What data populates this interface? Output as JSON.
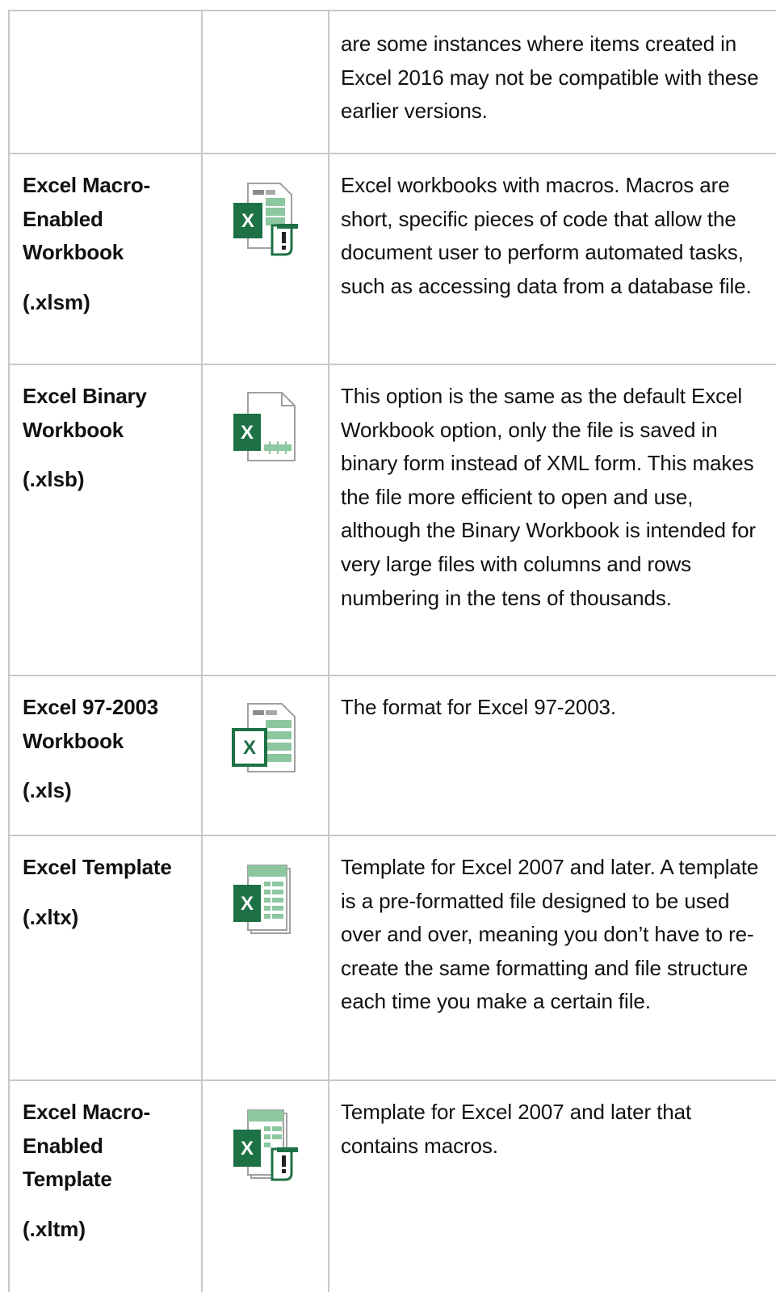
{
  "rows": [
    {
      "name": "",
      "extension": "",
      "icon": "",
      "description": "are some instances where items created in Excel 2016 may not be compatible with these earlier versions."
    },
    {
      "name": "Excel Macro-Enabled Workbook",
      "extension": "(.xlsm)",
      "icon": "excel-macro-workbook-icon",
      "description": "Excel workbooks with macros. Macros are short, specific pieces of code that allow the document user to perform automated tasks, such as accessing data from a database file."
    },
    {
      "name": "Excel Binary Workbook",
      "extension": "(.xlsb)",
      "icon": "excel-binary-workbook-icon",
      "description": "This option is the same as the default Excel Workbook option, only the file is saved in binary form instead of XML form. This makes the file more efficient to open and use, although the Binary Workbook is intended for very large files with columns and rows numbering in the tens of thousands."
    },
    {
      "name": "Excel 97-2003 Workbook",
      "extension": "(.xls)",
      "icon": "excel-97-2003-workbook-icon",
      "description": "The format for Excel 97-2003."
    },
    {
      "name": "Excel Template",
      "extension": "(.xltx)",
      "icon": "excel-template-icon",
      "description": "Template for Excel 2007 and later. A template is a pre-formatted file designed to be used over and over, meaning you don’t have to re-create the same formatting and file structure each time you make a certain file."
    },
    {
      "name": "Excel Macro-Enabled Template",
      "extension": "(.xltm)",
      "icon": "excel-macro-template-icon",
      "description": "Template for Excel 2007 and later that contains macros."
    }
  ],
  "colors": {
    "excel_green": "#1e7145",
    "light_green": "#8cc7a0",
    "border": "#c8c8c8",
    "grey_sheet": "#a0a0a0"
  }
}
